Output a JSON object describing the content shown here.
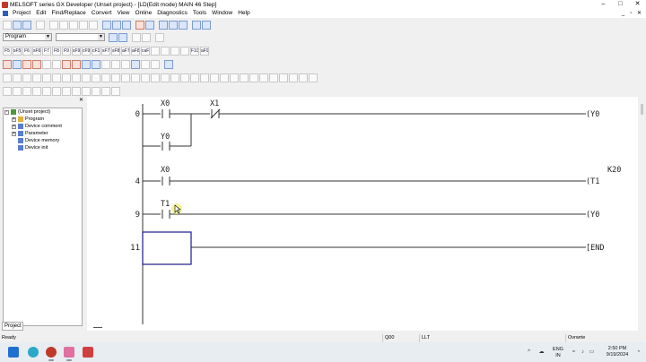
{
  "window": {
    "title": "MELSOFT series GX Developer (Unset project) - [LD(Edit mode)   MAIN   46 Step]",
    "controls": {
      "minimize": "–",
      "maximize": "□",
      "close": "✕"
    },
    "mdi_controls": {
      "minimize": "_",
      "restore": "▫",
      "close": "✕"
    }
  },
  "menu": {
    "items": [
      "Project",
      "Edit",
      "Find/Replace",
      "Convert",
      "View",
      "Online",
      "Diagnostics",
      "Tools",
      "Window",
      "Help"
    ]
  },
  "toolbar": {
    "data_type_select": "Program",
    "second_select": ""
  },
  "project_tree": {
    "root": "(Unset project)",
    "items": [
      "Program",
      "Device comment",
      "Parameter",
      "Device memory",
      "Device init"
    ],
    "tab": "Project"
  },
  "ladder": {
    "rungs": [
      {
        "step": "0",
        "contacts": [
          {
            "device": "X0",
            "type": "NO"
          },
          {
            "device": "X1",
            "type": "NC"
          }
        ],
        "branch": {
          "device": "Y0",
          "type": "NO"
        },
        "coil": "(Y0"
      },
      {
        "step": "4",
        "contacts": [
          {
            "device": "X0",
            "type": "NO"
          }
        ],
        "coil": "(T1",
        "set_value": "K20"
      },
      {
        "step": "9",
        "contacts": [
          {
            "device": "T1",
            "type": "NO"
          }
        ],
        "coil": "(Y0"
      },
      {
        "step": "11",
        "contacts": [],
        "coil": "[END"
      }
    ]
  },
  "status_bar": {
    "message": "Ready",
    "cpu": "Q00",
    "connection": "LLT",
    "mode": "Ovrwrte"
  },
  "taskbar": {
    "tray": {
      "language": "ENG",
      "region": "IN",
      "time": "2:50 PM",
      "date": "9/19/2024"
    }
  },
  "colors": {
    "accent_blue": "#2b5fb5",
    "cursor_highlight": "#f3ef7a",
    "selection_box": "#1a1a8c"
  }
}
